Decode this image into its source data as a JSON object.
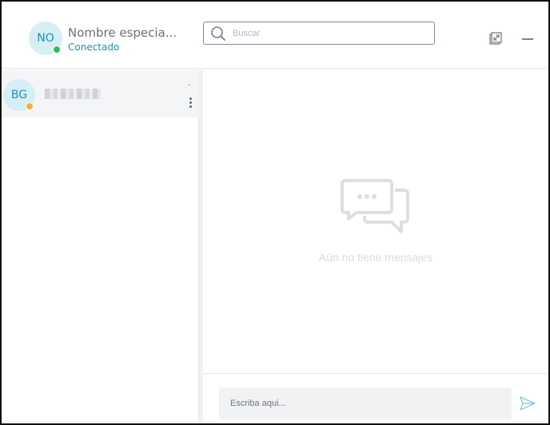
{
  "header": {
    "avatar_initials": "NO",
    "user_name": "Nombre especia...",
    "status": "Conectado",
    "status_color": "#2fbf57"
  },
  "search": {
    "placeholder": "Buscar",
    "icon": "search-icon"
  },
  "window_controls": {
    "popout_icon": "popout-icon",
    "minimize_icon": "minimize-icon"
  },
  "contacts": [
    {
      "initials": "BG",
      "name_blurred": true,
      "time": "-",
      "status_color": "#f5b23e"
    }
  ],
  "chat": {
    "empty_message": "Aún no tiene mensajes",
    "empty_icon": "chat-bubbles-icon"
  },
  "composer": {
    "placeholder": "Escriba aqui...",
    "send_icon": "send-icon"
  },
  "colors": {
    "accent": "#1c93ad",
    "avatar_bg": "#d6eef5"
  }
}
